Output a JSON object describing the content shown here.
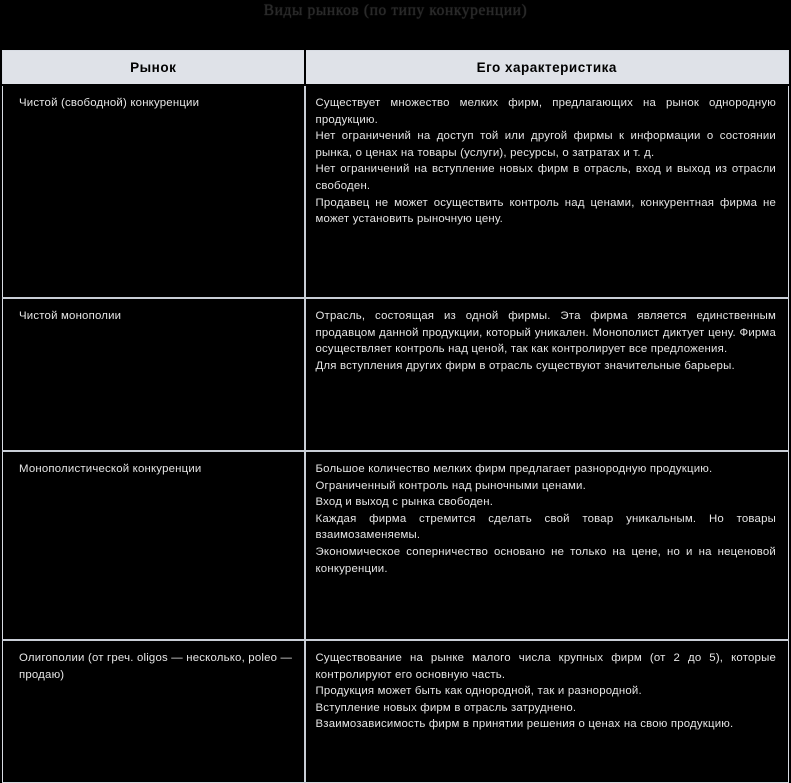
{
  "document": {
    "title": "Виды рынков (по типу конкуренции)"
  },
  "table": {
    "headers": {
      "market": "Рынок",
      "characteristic": "Его характеристика"
    },
    "rows": [
      {
        "market": "Чистой (свободной) конкуренции",
        "lines": [
          "Существует множество мелких фирм, предлагающих на рынок однородную продукцию.",
          "Нет ограничений на доступ той или другой фирмы к информации о состоянии рынка, о ценах на товары (услуги), ресурсы, о затратах и т. д.",
          "Нет ограничений на вступление новых фирм в отрасль, вход и выход из отрасли свободен.",
          "Продавец не может осуществить контроль над ценами, конкурентная фирма не может установить рыночную цену."
        ]
      },
      {
        "market": "Чистой монополии",
        "lines": [
          "Отрасль, состоящая из одной фирмы. Эта фирма является единственным продавцом данной продукции, который уникален. Монополист диктует цену. Фирма осуществляет контроль над ценой, так как контролирует все предложения.",
          "Для вступления других фирм в отрасль существуют значительные барьеры."
        ]
      },
      {
        "market": "Монополистической конкуренции",
        "lines": [
          "Большое количество мелких фирм предлагает разнородную продукцию.",
          "Ограниченный контроль над рыночными ценами.",
          "Вход и выход с рынка свободен.",
          "Каждая фирма стремится сделать свой товар уникальным. Но товары взаимозаменяемы.",
          "Экономическое соперничество основано не только на цене, но и на неценовой конкуренции."
        ]
      },
      {
        "market": "Олигополии (от греч. oligos — несколько, poleo — продаю)",
        "lines": [
          "Существование на рынке малого числа крупных фирм (от 2 до 5), которые контролируют его основную часть.",
          "Продукция может быть как однородной, так и разнородной.",
          "Вступление новых фирм в отрасль затруднено.",
          "Взаимозависимость фирм в принятии решения о ценах на свою продукцию."
        ]
      }
    ]
  },
  "colors": {
    "background": "#000000",
    "header_bg": "#dfe2e8",
    "header_text": "#000000",
    "body_text": "#e6e6e6",
    "border": "#c9ced6",
    "title_text": "#2a2a2a"
  }
}
